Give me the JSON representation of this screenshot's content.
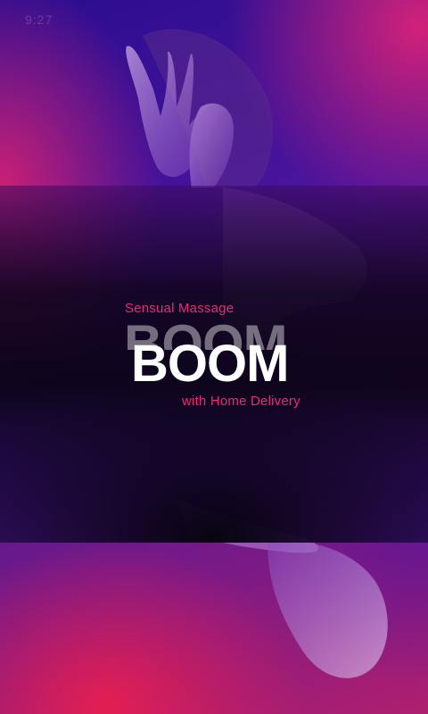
{
  "status_bar": {
    "time": "9:27"
  },
  "splash": {
    "tagline_top": "Sensual Massage",
    "logo_text": "BOOM",
    "tagline_bottom": "with Home Delivery"
  },
  "colors": {
    "accent": "#ea2a72",
    "logo": "#ffffff",
    "background_top_left": "#2b0d8f",
    "background_top_right": "#da2278",
    "background_bottom_left": "#e81e50"
  },
  "background_image": "model-photo-silhouette"
}
